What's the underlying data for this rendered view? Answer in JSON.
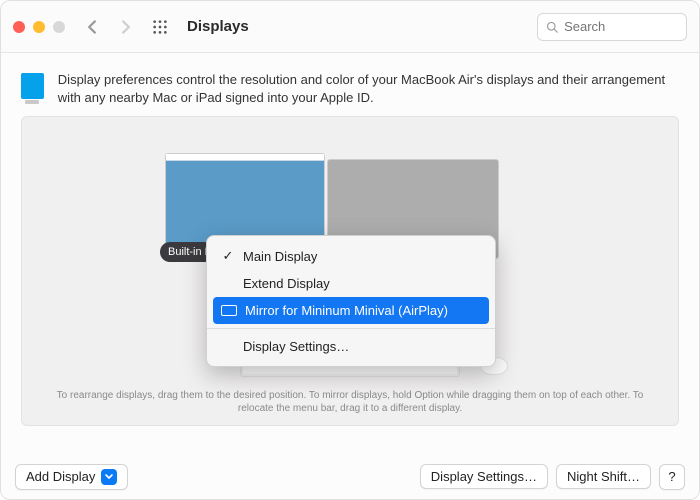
{
  "header": {
    "title": "Displays",
    "search_placeholder": "Search"
  },
  "intro": {
    "text": "Display preferences control the resolution and color of your MacBook Air's displays and their arrangement with any nearby Mac or iPad signed into your Apple ID."
  },
  "displays": [
    {
      "label": "Built-in Retina Display",
      "role": "primary"
    },
    {
      "label": "Mininum Minival (AirPlay)",
      "role": "secondary"
    }
  ],
  "menu": {
    "items": [
      {
        "label": "Main Display",
        "checked": true
      },
      {
        "label": "Extend Display",
        "checked": false
      },
      {
        "label": "Mirror for Mininum Minival (AirPlay)",
        "selected": true
      },
      {
        "label": "Display Settings…"
      }
    ]
  },
  "hint": "To rearrange displays, drag them to the desired position. To mirror displays, hold Option while dragging them on top of each other. To relocate the menu bar, drag it to a different display.",
  "footer": {
    "add_display": "Add Display",
    "display_settings": "Display Settings…",
    "night_shift": "Night Shift…",
    "help": "?"
  }
}
